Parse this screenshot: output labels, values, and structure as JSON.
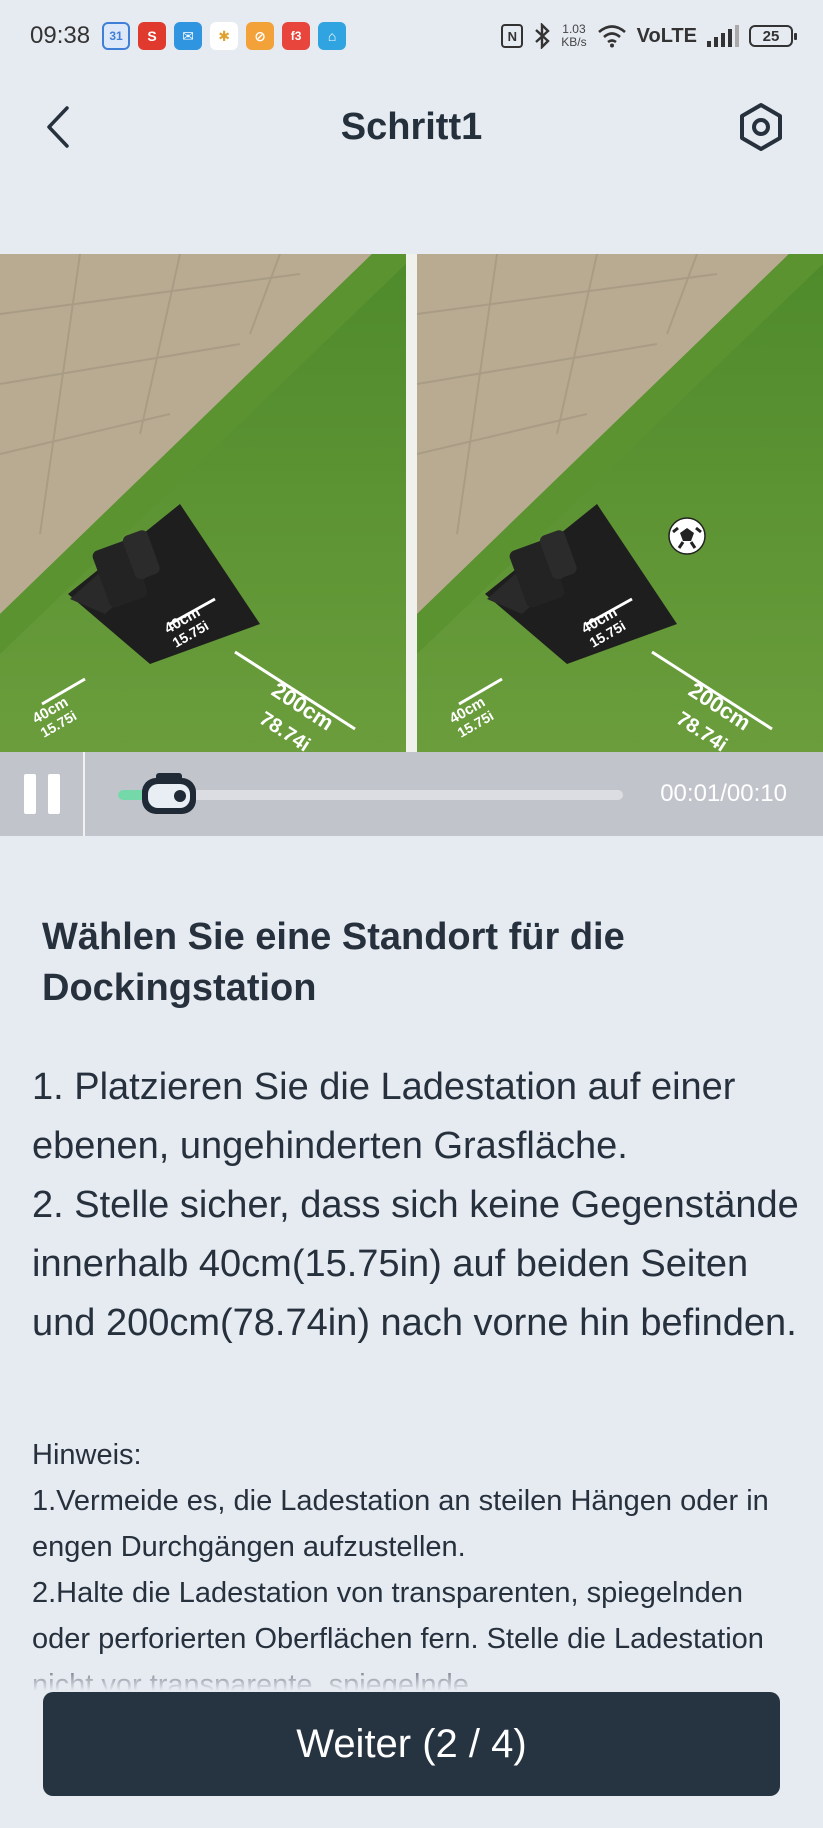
{
  "status_bar": {
    "time": "09:38",
    "app_icons": [
      {
        "name": "calendar-app-icon",
        "text": "31",
        "color": "#3f7fd8"
      },
      {
        "name": "s-app-icon",
        "text": "S",
        "color": "#e03a2f"
      },
      {
        "name": "mail-app-icon",
        "text": "✉",
        "color": "#2f95e0"
      },
      {
        "name": "slack-app-icon",
        "text": "✱",
        "color": "#ffffff"
      },
      {
        "name": "orange-app-icon",
        "text": "⊘",
        "color": "#f3a23a"
      },
      {
        "name": "red-app-icon",
        "text": "f3",
        "color": "#e8453c"
      },
      {
        "name": "home-app-icon",
        "text": "⌂",
        "color": "#2fa4e0"
      }
    ],
    "nfc": "N",
    "speed_value": "1.03",
    "speed_unit": "KB/s",
    "network": "VoLTE",
    "battery": "25"
  },
  "header": {
    "title": "Schritt1"
  },
  "video": {
    "left_labels": {
      "side1": "40cm",
      "side1_in": "15.75i",
      "side2": "40cm",
      "side2_in": "15.75i",
      "front": "200cm",
      "front_in": "78.74i"
    },
    "right_labels": {
      "side1": "40cm",
      "side1_in": "15.75i",
      "side2": "40cm",
      "side2_in": "15.75i",
      "front": "200cm",
      "front_in": "78.74i"
    },
    "progress_fraction": 0.1,
    "timecode": "00:01/00:10"
  },
  "content": {
    "title": "Wählen Sie eine Standort für die Dockingstation",
    "instructions": "1. Platzieren Sie die Ladestation auf einer ebenen, ungehinderten Grasfläche.\n2. Stelle sicher, dass sich keine Gegenstände innerhalb 40cm(15.75in) auf beiden Seiten und 200cm(78.74in) nach vorne hin befinden.",
    "hint": "Hinweis:\n1.Vermeide es, die Ladestation an steilen Hängen oder in engen Durchgängen aufzustellen.\n2.Halte die Ladestation von transparenten, spiegelnden oder perforierten Oberflächen fern. Stelle die Ladestation nicht vor transparente, spiegelnde"
  },
  "footer": {
    "next_label": "Weiter (2 / 4)"
  },
  "colors": {
    "background": "#e6eaf1",
    "button": "#263441",
    "progress": "#74d8a8"
  }
}
